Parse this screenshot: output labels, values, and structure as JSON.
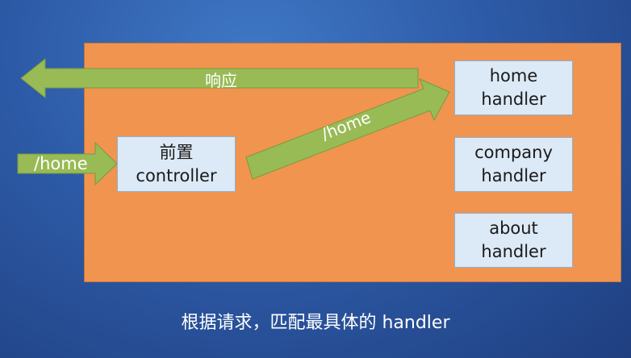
{
  "diagram": {
    "controller": {
      "line1": "前置",
      "line2": "controller"
    },
    "handlers": [
      {
        "line1": "home",
        "line2": "handler"
      },
      {
        "line1": "company",
        "line2": "handler"
      },
      {
        "line1": "about",
        "line2": "handler"
      }
    ],
    "arrows": {
      "response_label": "响应",
      "incoming_label": "/home",
      "forward_label": "/home"
    },
    "caption": "根据请求，匹配最具体的 handler"
  },
  "colors": {
    "background": "#2d5aa6",
    "panel": "#f0944f",
    "box": "#dce9f6",
    "arrow": "#98bb55"
  }
}
